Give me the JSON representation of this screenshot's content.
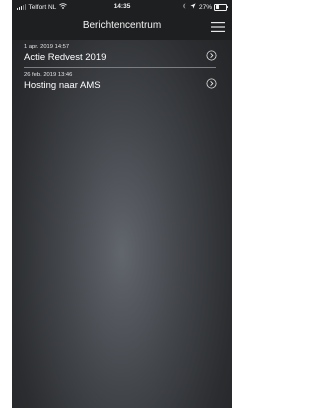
{
  "status_bar": {
    "carrier": "Telfort NL",
    "time": "14:35",
    "battery": "27%",
    "battery_fraction": 0.27,
    "icons": [
      "signal-icon",
      "wifi-icon",
      "alarm-icon",
      "location-icon",
      "battery-icon"
    ]
  },
  "header": {
    "title": "Berichtencentrum",
    "menu_icon": "hamburger-menu-icon"
  },
  "messages": [
    {
      "date": "1 apr. 2019 14:57",
      "title": "Actie Redvest 2019"
    },
    {
      "date": "26 feb. 2019 13:46",
      "title": "Hosting naar AMS"
    }
  ],
  "colors": {
    "bar_background": "#1e1f21",
    "background_center": "#62666d",
    "background_edge": "#212224",
    "text": "#ffffff"
  }
}
